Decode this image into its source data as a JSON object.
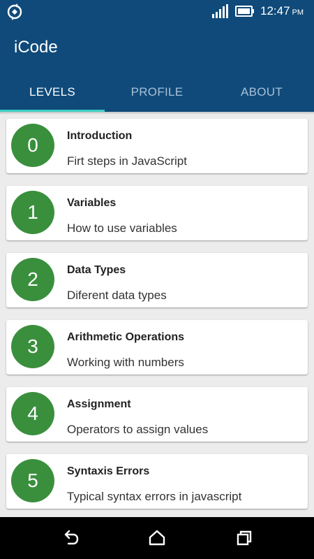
{
  "status_bar": {
    "time": "12:47",
    "ampm": "PM"
  },
  "app": {
    "title": "iCode"
  },
  "tabs": [
    {
      "label": "LEVELS",
      "active": true
    },
    {
      "label": "PROFILE",
      "active": false
    },
    {
      "label": "ABOUT",
      "active": false
    }
  ],
  "levels": [
    {
      "number": "0",
      "title": "Introduction",
      "description": "Firt steps in JavaScript"
    },
    {
      "number": "1",
      "title": "Variables",
      "description": "How to use variables"
    },
    {
      "number": "2",
      "title": "Data Types",
      "description": "Diferent data types"
    },
    {
      "number": "3",
      "title": "Arithmetic Operations",
      "description": "Working with numbers"
    },
    {
      "number": "4",
      "title": "Assignment",
      "description": "Operators to assign values"
    },
    {
      "number": "5",
      "title": "Syntaxis Errors",
      "description": "Typical syntax errors in javascript"
    }
  ],
  "colors": {
    "primary": "#0f4a7a",
    "tab_indicator": "#3fd0c2",
    "level_circle": "#3a8f3d"
  },
  "icons": {
    "status_left": "sync-icon",
    "signal": "signal-icon",
    "battery": "battery-icon",
    "nav_back": "back-icon",
    "nav_home": "home-icon",
    "nav_recents": "recents-icon"
  }
}
